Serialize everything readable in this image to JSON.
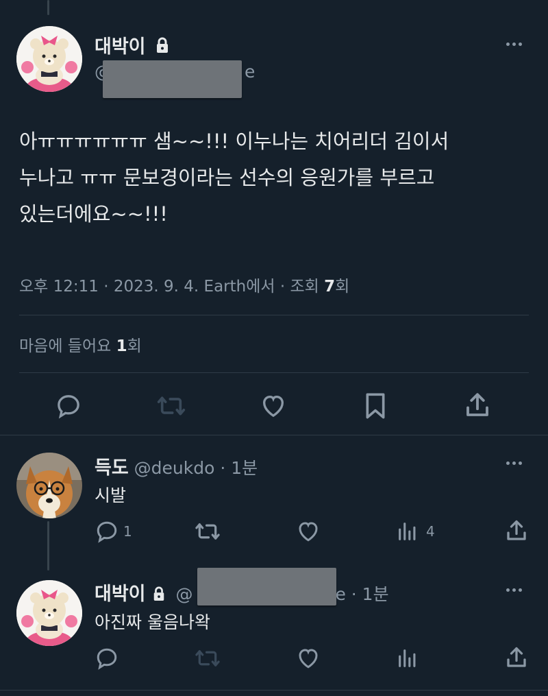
{
  "main_tweet": {
    "display_name": "대박이",
    "handle_prefix": "@",
    "handle_suffix": "e",
    "text_lines": [
      "아ㅠㅠㅠㅠㅠㅠ 샘~~!!! 이누나는 치어리더 김이서",
      "누나고 ㅠㅠ 문보경이라는 선수의 응원가를 부르고",
      "있는더에요~~!!!"
    ],
    "meta": {
      "time": "오후 12:11",
      "sep1": " · ",
      "date": "2023. 9. 4.",
      "sep2": " ",
      "source": "Earth에서",
      "sep3": " · ",
      "views_label": "조회 ",
      "views_count": "7",
      "views_unit": "회"
    },
    "likes": {
      "label": "마음에 들어요 ",
      "count": "1",
      "unit": "회"
    }
  },
  "reply1": {
    "display_name": "득도",
    "handle": "@deukdo",
    "sep": " · ",
    "time": "1분",
    "text": "시발",
    "reply_count": "1",
    "views_count": "4"
  },
  "reply2": {
    "display_name": "대박이",
    "handle_prefix": "@",
    "handle_suffix": "e",
    "sep": " · ",
    "time": "1분",
    "text": "아진짜 울음나왁"
  },
  "icons": [
    "reply-icon",
    "retweet-icon",
    "like-icon",
    "bookmark-icon",
    "share-icon",
    "views-icon",
    "lock-icon",
    "more-icon"
  ],
  "colors": {
    "background": "#15202b",
    "text": "#e7e9ea",
    "muted": "#8b98a5",
    "retweet_disabled": "#3a4a5a",
    "divider": "#2f3b47"
  }
}
